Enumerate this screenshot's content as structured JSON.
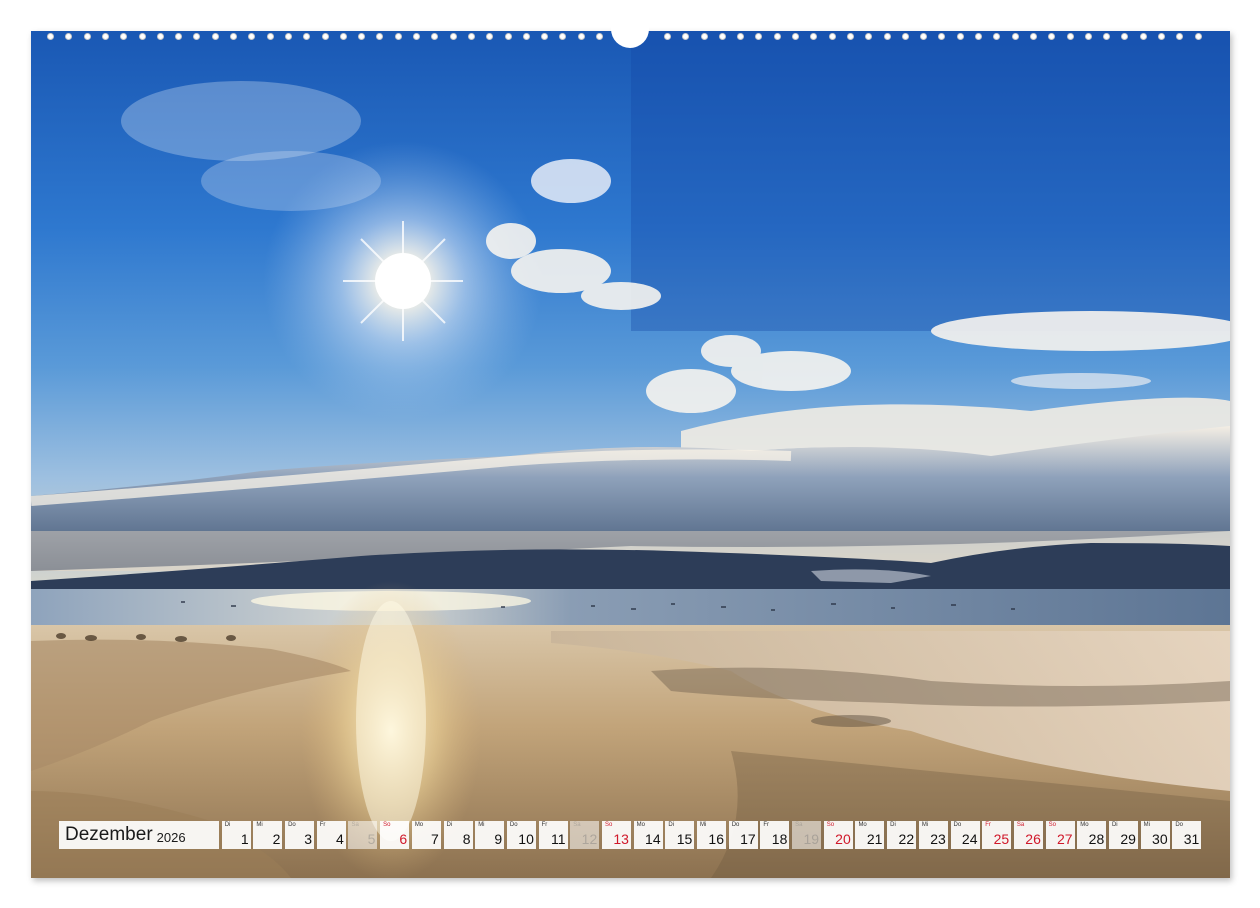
{
  "calendar": {
    "month": "Dezember",
    "year": "2026",
    "days": [
      {
        "wd": "Di",
        "num": "1",
        "kind": "normal"
      },
      {
        "wd": "Mi",
        "num": "2",
        "kind": "normal"
      },
      {
        "wd": "Do",
        "num": "3",
        "kind": "normal"
      },
      {
        "wd": "Fr",
        "num": "4",
        "kind": "normal"
      },
      {
        "wd": "Sa",
        "num": "5",
        "kind": "dim"
      },
      {
        "wd": "So",
        "num": "6",
        "kind": "red"
      },
      {
        "wd": "Mo",
        "num": "7",
        "kind": "normal"
      },
      {
        "wd": "Di",
        "num": "8",
        "kind": "normal"
      },
      {
        "wd": "Mi",
        "num": "9",
        "kind": "normal"
      },
      {
        "wd": "Do",
        "num": "10",
        "kind": "normal"
      },
      {
        "wd": "Fr",
        "num": "11",
        "kind": "normal"
      },
      {
        "wd": "Sa",
        "num": "12",
        "kind": "dim"
      },
      {
        "wd": "So",
        "num": "13",
        "kind": "red"
      },
      {
        "wd": "Mo",
        "num": "14",
        "kind": "normal"
      },
      {
        "wd": "Di",
        "num": "15",
        "kind": "normal"
      },
      {
        "wd": "Mi",
        "num": "16",
        "kind": "normal"
      },
      {
        "wd": "Do",
        "num": "17",
        "kind": "normal"
      },
      {
        "wd": "Fr",
        "num": "18",
        "kind": "normal"
      },
      {
        "wd": "Sa",
        "num": "19",
        "kind": "dim"
      },
      {
        "wd": "So",
        "num": "20",
        "kind": "red"
      },
      {
        "wd": "Mo",
        "num": "21",
        "kind": "normal"
      },
      {
        "wd": "Di",
        "num": "22",
        "kind": "normal"
      },
      {
        "wd": "Mi",
        "num": "23",
        "kind": "normal"
      },
      {
        "wd": "Do",
        "num": "24",
        "kind": "normal"
      },
      {
        "wd": "Fr",
        "num": "25",
        "kind": "red"
      },
      {
        "wd": "Sa",
        "num": "26",
        "kind": "red"
      },
      {
        "wd": "So",
        "num": "27",
        "kind": "red"
      },
      {
        "wd": "Mo",
        "num": "28",
        "kind": "normal"
      },
      {
        "wd": "Di",
        "num": "29",
        "kind": "normal"
      },
      {
        "wd": "Mi",
        "num": "30",
        "kind": "normal"
      },
      {
        "wd": "Do",
        "num": "31",
        "kind": "normal"
      }
    ]
  },
  "colors": {
    "sky_top": "#1f5fb8",
    "sky_mid": "#3d86d6",
    "holiday_red": "#d0182a",
    "sand": "#b89a72"
  }
}
